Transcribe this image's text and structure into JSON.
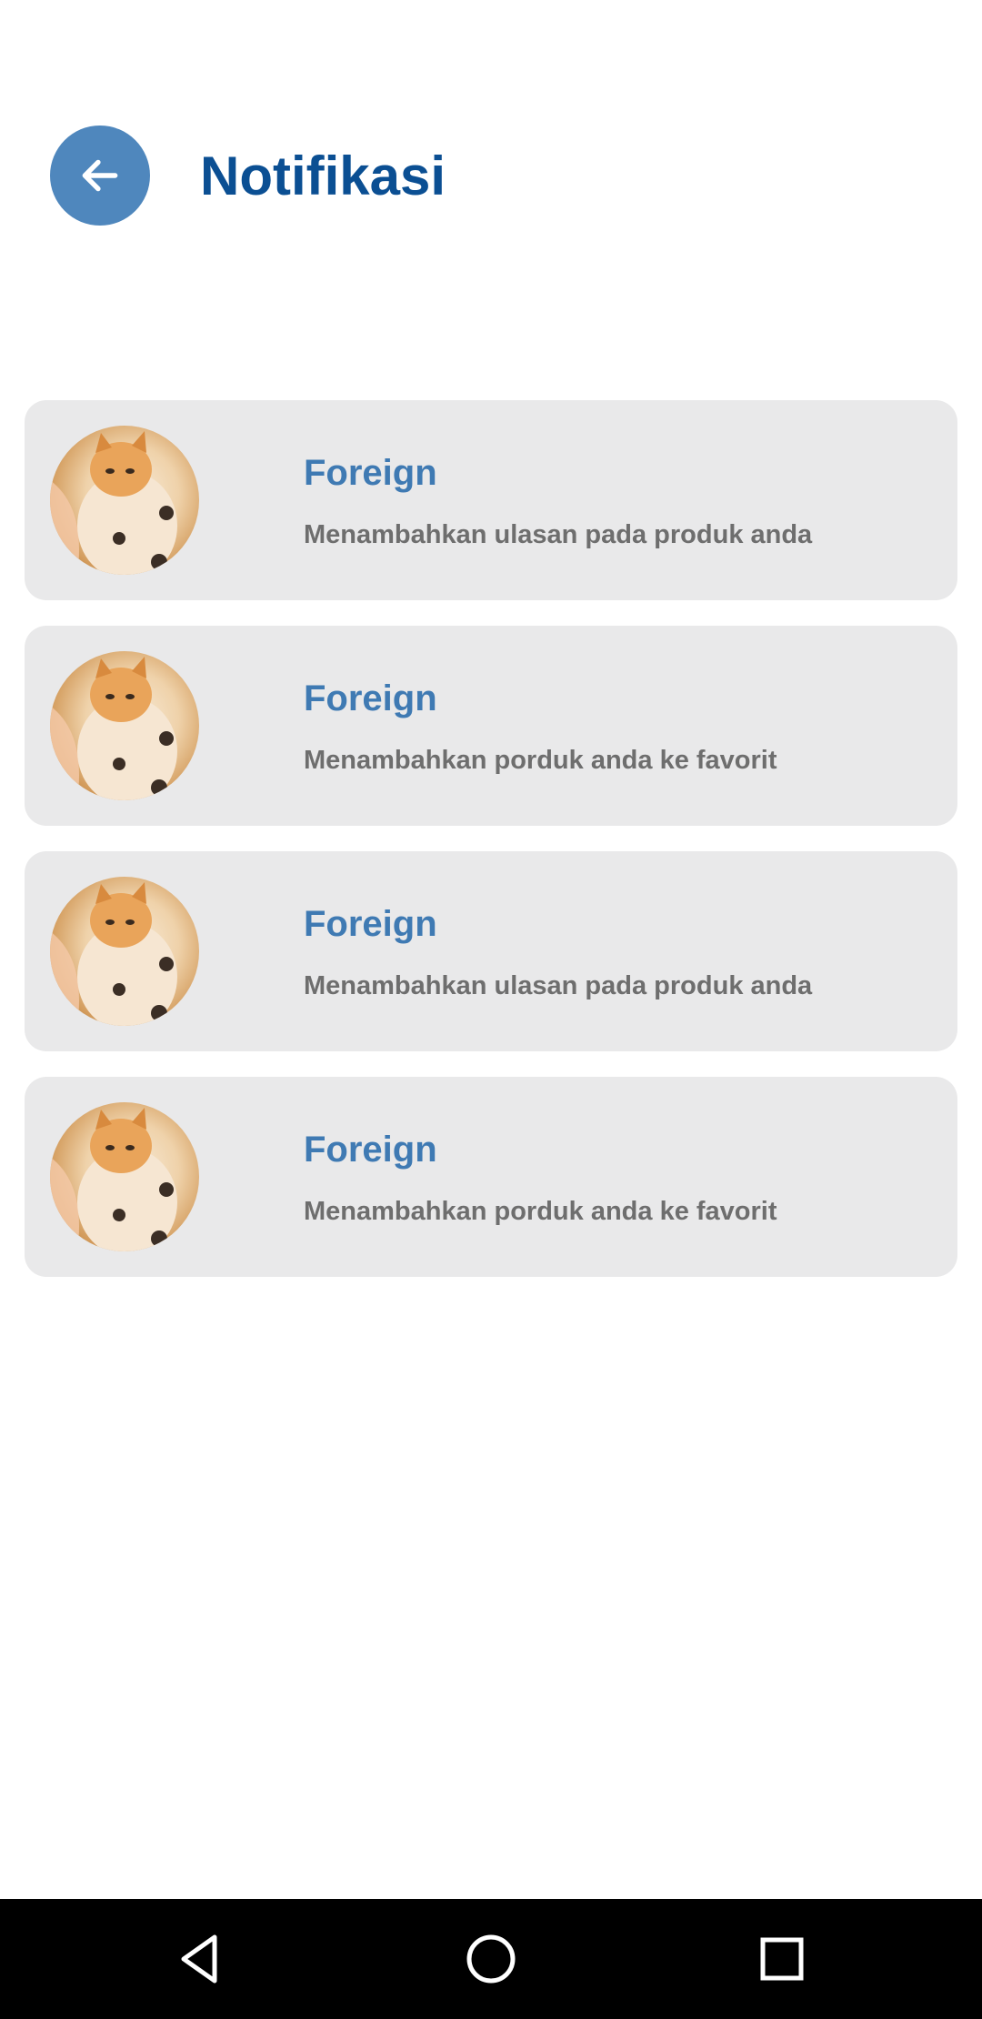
{
  "header": {
    "title": "Notifikasi",
    "back_icon": "arrow-left-icon"
  },
  "notifications": [
    {
      "name": "Foreign",
      "message": "Menambahkan ulasan pada produk anda",
      "avatar": "kitten-avatar"
    },
    {
      "name": "Foreign",
      "message": "Menambahkan porduk anda ke favorit",
      "avatar": "kitten-avatar"
    },
    {
      "name": "Foreign",
      "message": "Menambahkan ulasan pada produk anda",
      "avatar": "kitten-avatar"
    },
    {
      "name": "Foreign",
      "message": "Menambahkan porduk anda ke favorit",
      "avatar": "kitten-avatar"
    }
  ],
  "navbar": {
    "back_icon": "triangle-back-icon",
    "home_icon": "circle-home-icon",
    "recents_icon": "square-recents-icon"
  },
  "colors": {
    "accent": "#4f87bd",
    "title": "#0b4f93",
    "name": "#3f7ab3",
    "card_bg": "#e9e9ea",
    "message": "#6e6e6e"
  }
}
